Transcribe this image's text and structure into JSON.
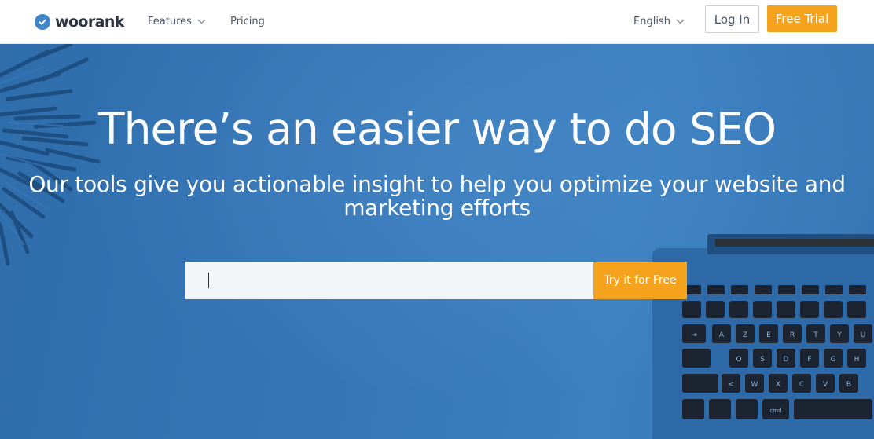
{
  "header": {
    "logo_text": "woorank",
    "nav": {
      "features_label": "Features",
      "pricing_label": "Pricing"
    },
    "language_label": "English",
    "login_label": "Log In",
    "free_trial_label": "Free Trial"
  },
  "hero": {
    "title": "There’s an easier way to do SEO",
    "subtitle": "Our tools give you actionable insight to help you optimize your website and marketing efforts",
    "search": {
      "value": "",
      "placeholder": ""
    },
    "try_label": "Try it for Free"
  },
  "keyboard": {
    "row1": [
      "",
      "",
      "",
      "",
      "",
      "",
      "",
      "",
      ""
    ],
    "row2": [
      "",
      "",
      "",
      "",
      "",
      "",
      "",
      ""
    ],
    "row3": [
      "⇥",
      "A",
      "Z",
      "E",
      "R",
      "T",
      "Y",
      "U"
    ],
    "row4": [
      "",
      "Q",
      "S",
      "D",
      "F",
      "G",
      "H"
    ],
    "row5": [
      "",
      "<",
      "W",
      "X",
      "C",
      "V",
      "B"
    ],
    "row6": [
      "",
      "",
      "",
      "cmd",
      ""
    ]
  },
  "colors": {
    "brand_blue": "#3f86c8",
    "accent_orange": "#f5a31c",
    "hero_blue": "#3577b8",
    "header_text": "#4a5566"
  }
}
